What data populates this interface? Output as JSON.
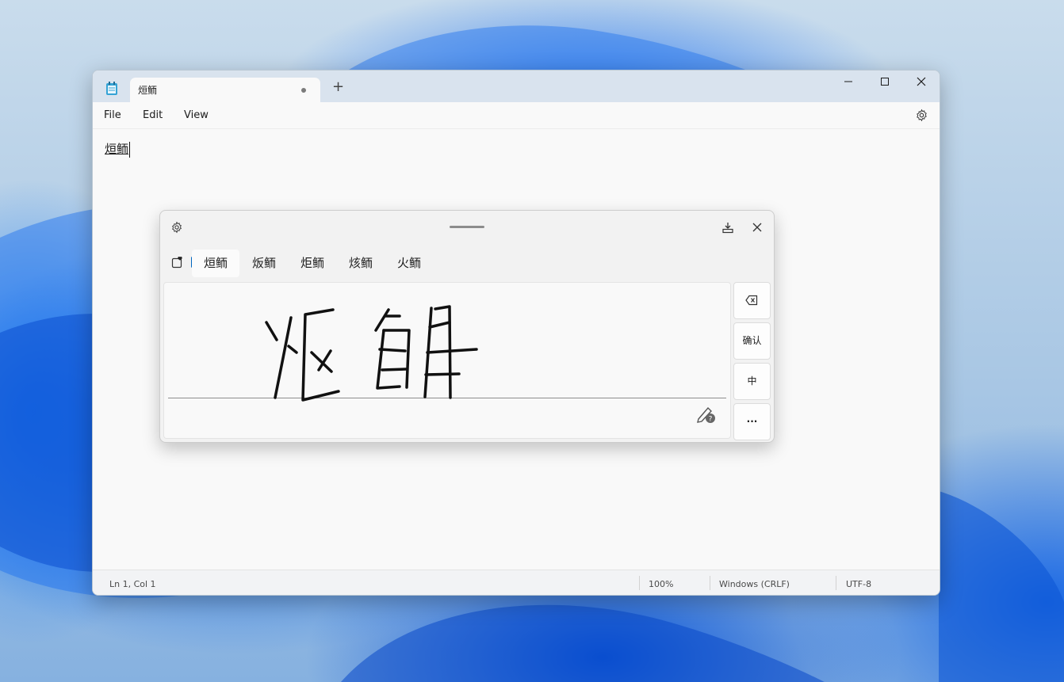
{
  "notepad": {
    "tab_title": "烜鲕",
    "menu": [
      "File",
      "Edit",
      "View"
    ],
    "document_text": "烜鲕",
    "status": {
      "position": "Ln 1, Col 1",
      "zoom": "100%",
      "line_ending": "Windows (CRLF)",
      "encoding": "UTF-8"
    }
  },
  "handwriting_panel": {
    "candidates": [
      "烜鲕",
      "炍鲕",
      "炬鲕",
      "烗鲕",
      "火鲕"
    ],
    "selected_candidate_index": 0,
    "buttons": {
      "confirm": "确认",
      "mode": "中",
      "more": "..."
    }
  },
  "icons": {
    "app": "notepad-icon",
    "settings": "gear-icon",
    "backspace": "backspace-icon",
    "dock": "dock-icon",
    "close": "close-icon",
    "favorite": "favorites-icon",
    "pen_help": "pen-help-icon"
  },
  "colors": {
    "accent": "#0067c0",
    "titlebar": "#d9e3ee"
  }
}
